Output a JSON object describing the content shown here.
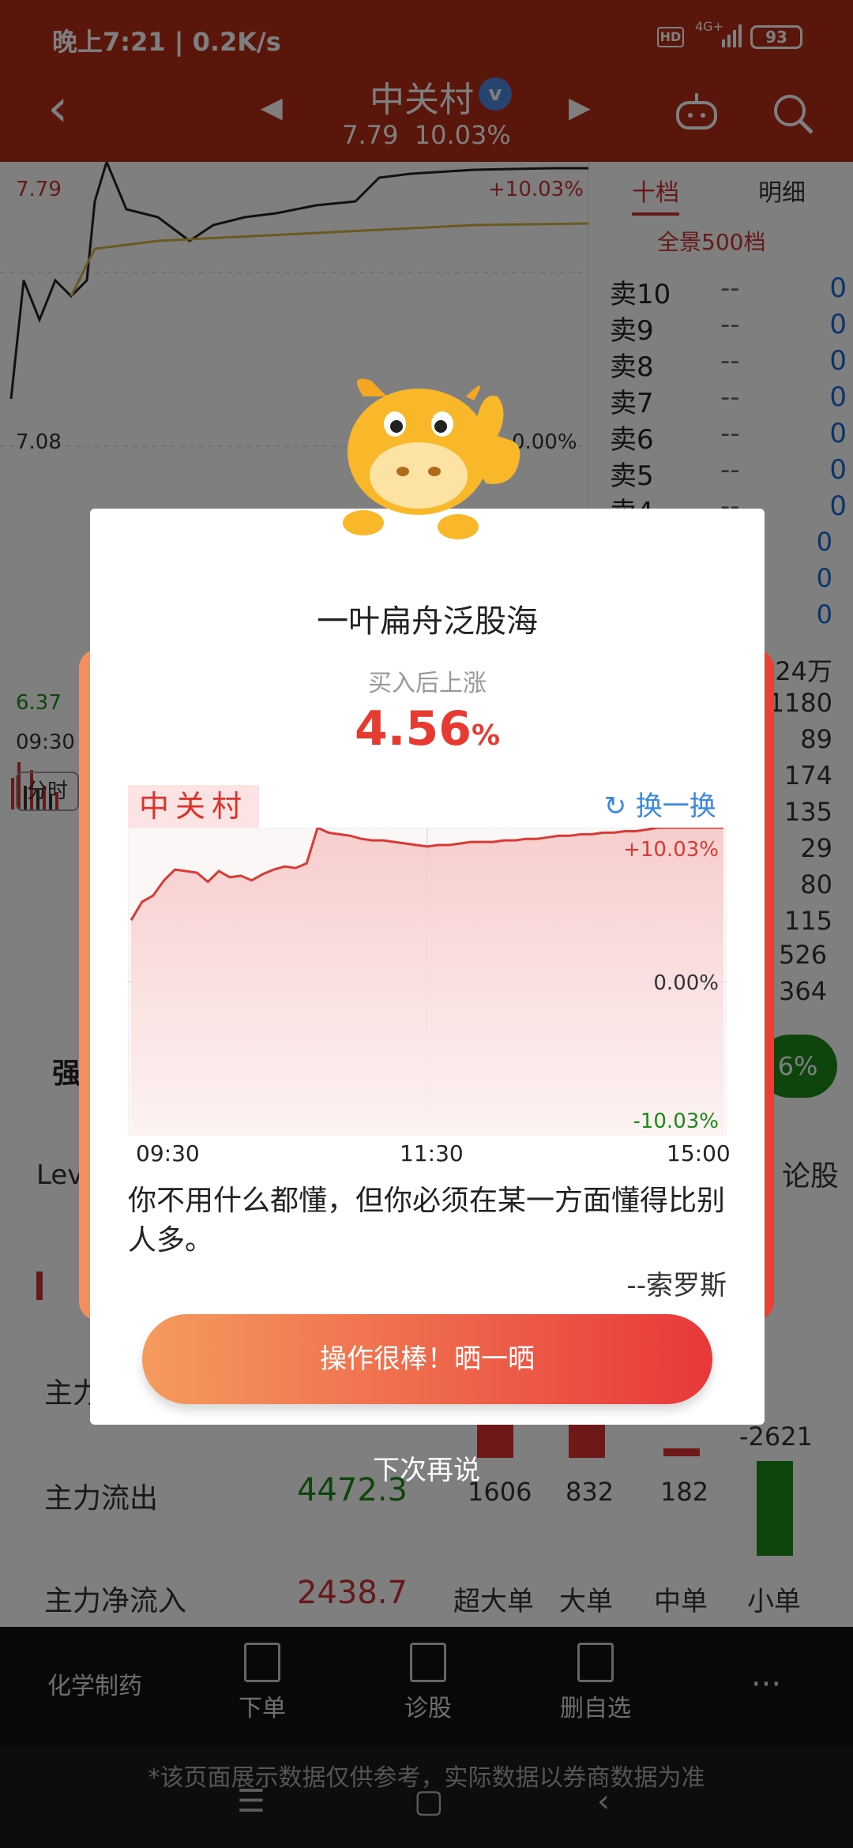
{
  "status": {
    "time": "晚上7:21 | 0.2K/s",
    "hd": "HD",
    "signal": "4G+",
    "battery": "93"
  },
  "header": {
    "title": "中关村",
    "price": "7.79",
    "change": "10.03%"
  },
  "background": {
    "chart_high": "7.79",
    "chart_low": "7.08",
    "chart_pct_high": "+10.03%",
    "chart_pct_mid": "0.00%",
    "vol_val": "6.37",
    "time_label": "09:30",
    "tab_fenshi": "分时",
    "tab_shidang": "十档",
    "tab_mingxi": "明细",
    "panorama": "全景500档",
    "orderbook": [
      {
        "label": "卖10",
        "price": "--",
        "vol": "0"
      },
      {
        "label": "卖9",
        "price": "--",
        "vol": "0"
      },
      {
        "label": "卖8",
        "price": "--",
        "vol": "0"
      },
      {
        "label": "卖7",
        "price": "--",
        "vol": "0"
      },
      {
        "label": "卖6",
        "price": "--",
        "vol": "0"
      },
      {
        "label": "卖5",
        "price": "--",
        "vol": "0"
      },
      {
        "label": "卖4",
        "price": "--",
        "vol": "0"
      }
    ],
    "right_numbers": [
      "0",
      "0",
      "0",
      "24万",
      "1180",
      "89",
      "174",
      "135",
      "29",
      "80",
      "115",
      "526",
      "364"
    ],
    "side_pct": "6%",
    "side_label": "论股",
    "lev_text": "Lev",
    "qiang_text": "强",
    "flow": {
      "row1_label": "主力",
      "out_label": "主力流出",
      "out_value": "4472.3",
      "net_label": "主力净流入",
      "net_value": "2438.7",
      "bar_values": [
        "1606",
        "832",
        "182",
        "-2621"
      ],
      "col_labels": [
        "超大单",
        "大单",
        "中单",
        "小单"
      ]
    }
  },
  "bottom_nav": {
    "items": [
      "化学制药",
      "下单",
      "诊股",
      "删自选",
      "···"
    ],
    "disclaimer": "*该页面展示数据仅供参考，实际数据以券商数据为准"
  },
  "dialog": {
    "title": "一叶扁舟泛股海",
    "subtitle": "买入后上涨",
    "percent": "4.56",
    "percent_unit": "%",
    "stock_name": "中关村",
    "refresh_label": "换一换",
    "quote": "你不用什么都懂，但你必须在某一方面懂得比别人多。",
    "author": "--索罗斯",
    "share_button": "操作很棒！晒一晒",
    "later": "下次再说"
  },
  "chart_data": {
    "type": "line",
    "title": "",
    "x_ticks": [
      "09:30",
      "11:30",
      "15:00"
    ],
    "y_ticks": [
      "+10.03%",
      "0.00%",
      "-10.03%"
    ],
    "ylim": [
      -10.03,
      10.03
    ],
    "series": [
      {
        "values": [
          4,
          5.2,
          5.6,
          6.6,
          7.3,
          7.2,
          7.1,
          6.5,
          7.2,
          6.8,
          6.9,
          6.6,
          7,
          7.3,
          7.5,
          7.4,
          7.7,
          10.03,
          9.7,
          9.6,
          9.5,
          9.3,
          9.2,
          9.2,
          9.1,
          9.0,
          8.9,
          8.8,
          8.9,
          8.9,
          9.0,
          9.1,
          9.1,
          9.1,
          9.2,
          9.2,
          9.3,
          9.3,
          9.4,
          9.5,
          9.5,
          9.6,
          9.6,
          9.7,
          9.7,
          9.8,
          9.8,
          9.9,
          10.03,
          10.03,
          10.03,
          10.03,
          10.03,
          10.03,
          10.03
        ]
      }
    ]
  }
}
